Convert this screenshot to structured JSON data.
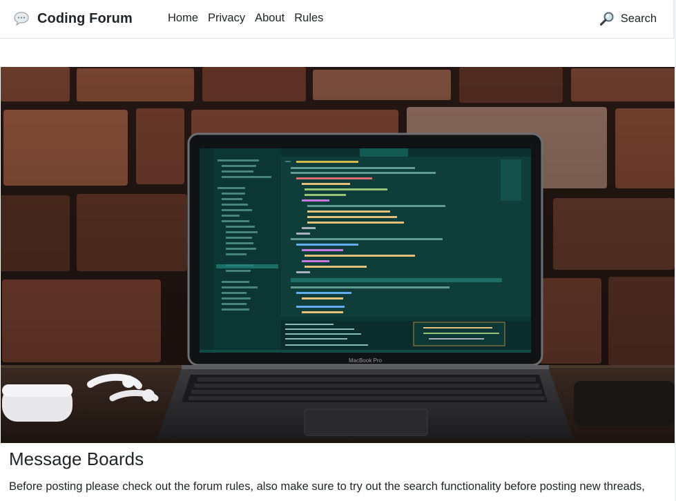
{
  "header": {
    "brand_icon": "speech-bubble-icon",
    "brand": "Coding Forum",
    "nav": [
      {
        "label": "Home"
      },
      {
        "label": "Privacy"
      },
      {
        "label": "About"
      },
      {
        "label": "Rules"
      }
    ],
    "search_icon": "magnifier-icon",
    "search_label": "Search"
  },
  "hero": {
    "image": "laptop-with-code-editor-on-desk-against-brick-wall",
    "laptop_brand_text": "MacBook Pro"
  },
  "main": {
    "title": "Message Boards",
    "intro": "Before posting please check out the forum rules, also make sure to try out the search functionality before posting new threads,"
  },
  "colors": {
    "text": "#212529",
    "navbar_border": "#dee2e6",
    "editor_bg": "#0f3d3a",
    "brick": "#6b3a2c"
  }
}
